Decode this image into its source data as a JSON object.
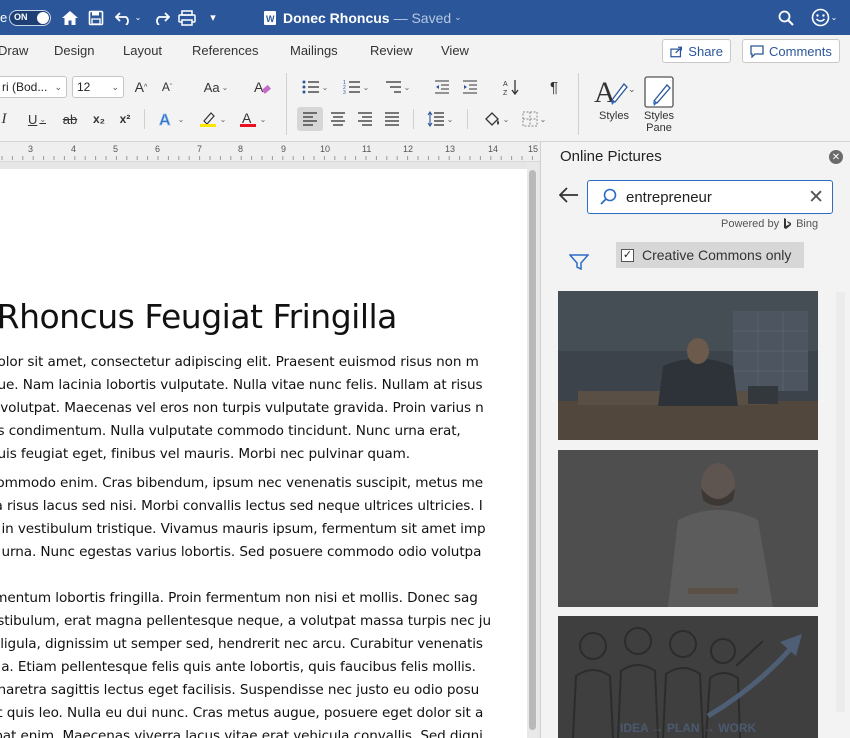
{
  "titlebar": {
    "autosave_label": "e",
    "toggle_text": "ON",
    "doc_title": "Donec Rhoncus",
    "saved_status": "— Saved"
  },
  "tabs": [
    "Draw",
    "Design",
    "Layout",
    "References",
    "Mailings",
    "Review",
    "View"
  ],
  "actions": {
    "share": "Share",
    "comments": "Comments"
  },
  "ribbon": {
    "font_name": "ri (Bod...",
    "font_size": "12",
    "aa_label": "Aa",
    "styles_label": "Styles",
    "styles_pane_label": "Styles Pane",
    "underline": "U",
    "strike": "ab",
    "subscript": "x₂",
    "superscript": "x²",
    "italic": "I",
    "pilcrow": "¶"
  },
  "ruler_numbers": [
    "3",
    "4",
    "5",
    "6",
    "7",
    "8",
    "9",
    "10",
    "11",
    "12",
    "13",
    "14",
    "15"
  ],
  "document": {
    "heading": "c Rhoncus Feugiat Fringilla",
    "lines": [
      " dolor sit amet, consectetur adipiscing elit. Praesent euismod risus non m",
      "gue. Nam lacinia lobortis vulputate. Nulla vitae nunc felis. Nullam at risus",
      "s volutpat. Maecenas vel eros non turpis vulputate gravida. Proin varius n",
      "us condimentum. Nulla vulputate commodo tincidunt. Nunc urna erat,",
      " quis feugiat eget, finibus vel mauris. Morbi nec pulvinar quam.",
      "",
      "commodo enim. Cras bibendum, ipsum nec venenatis suscipit, metus me",
      "ra risus lacus sed nisi. Morbi convallis lectus sed neque ultrices ultricies. I",
      "o in vestibulum tristique. Vivamus mauris ipsum, fermentum sit amet imp",
      "a urna. Nunc egestas varius lobortis. Sed posuere commodo odio volutpa",
      "",
      "rmentum lobortis fringilla. Proin fermentum non nisi et mollis. Donec sag",
      "estibulum, erat magna pellentesque neque, a volutpat massa turpis nec ju",
      "s ligula, dignissim ut semper sed, hendrerit nec arcu. Curabitur venenatis",
      "ula. Etiam pellentesque felis quis ante lobortis, quis faucibus felis mollis.",
      " pharetra sagittis lectus eget facilisis. Suspendisse nec justo eu odio posu",
      "et quis leo. Nulla eu dui nunc. Cras metus augue, posuere eget dolor sit a",
      "tpat enim. Maecenas viverra lacus vitae erat vehicula convallis. Sed digni"
    ]
  },
  "pane": {
    "title": "Online Pictures",
    "search_value": "entrepreneur",
    "powered_by": "Powered by",
    "bing": "Bing",
    "creative_commons": "Creative Commons only",
    "thumb3_caption": "IDEA → PLAN → WORK"
  },
  "colors": {
    "titlebar": "#2b579a",
    "accent": "#2b6cc4",
    "font_color_red": "#e81123",
    "highlight_yellow": "#ffe600"
  }
}
